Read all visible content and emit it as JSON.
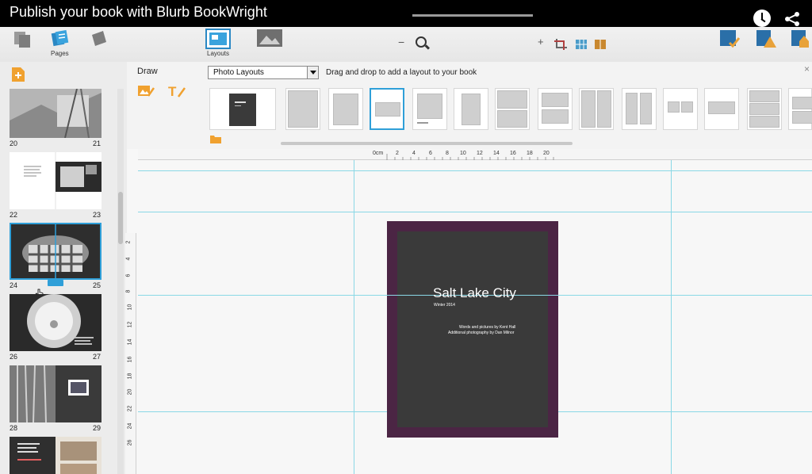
{
  "video": {
    "title": "Publish your book with Blurb BookWright"
  },
  "toolbar": {
    "pages_label": "Pages",
    "layouts_label": "Layouts",
    "zoom_minus": "−",
    "zoom_plus": "+"
  },
  "panel": {
    "draw_label": "Draw",
    "layout_dropdown_value": "Photo Layouts",
    "drag_hint": "Drag and drop to add a layout to your book",
    "close_symbol": "×"
  },
  "ruler": {
    "top_ticks": [
      "0cm",
      "2",
      "4",
      "6",
      "8",
      "10",
      "12",
      "14",
      "16",
      "18",
      "20"
    ],
    "left_ticks": [
      "2",
      "4",
      "6",
      "8",
      "10",
      "12",
      "14",
      "16",
      "18",
      "20",
      "22",
      "24",
      "26"
    ]
  },
  "thumbnails": [
    {
      "left_page": "20",
      "right_page": "21"
    },
    {
      "left_page": "22",
      "right_page": "23"
    },
    {
      "left_page": "24",
      "right_page": "25"
    },
    {
      "left_page": "26",
      "right_page": "27"
    },
    {
      "left_page": "28",
      "right_page": "29"
    }
  ],
  "cover": {
    "title": "Salt Lake City",
    "subtitle": "Winter 2014",
    "credit_line1": "Words and pictures by Kent Hall",
    "credit_line2": "Additional photography by Dan Milnor"
  },
  "colors": {
    "accent": "#2f9fd8",
    "cover_border": "#4b2544",
    "cover_fill": "#3a3a3a",
    "guide": "#8ad8e6"
  }
}
